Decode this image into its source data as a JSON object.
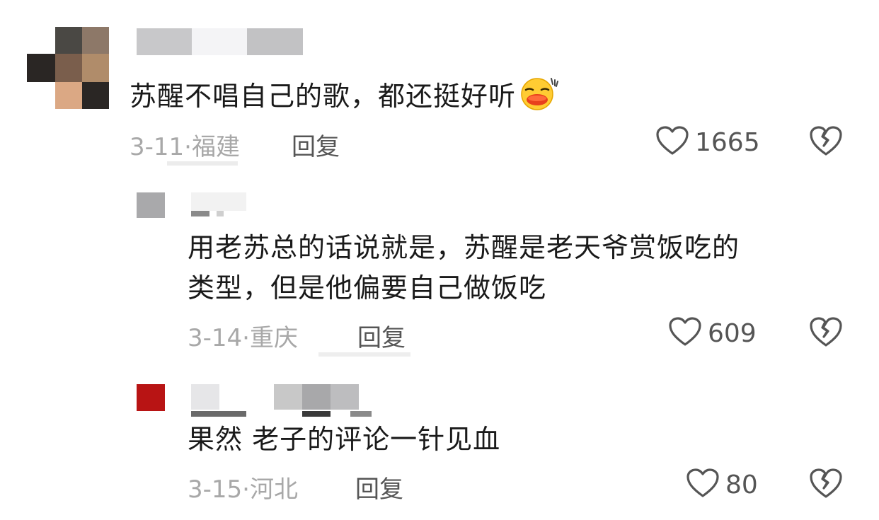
{
  "comments": [
    {
      "text": "苏醒不唱自己的歌，都还挺好听",
      "emoji": "duck-face-emoji",
      "date": "3-11",
      "separator": "·",
      "location": "福建",
      "reply_label": "回复",
      "likes": "1665"
    },
    {
      "text_line1": "用老苏总的话说就是，苏醒是老天爷赏饭吃的",
      "text_line2": "类型，但是他偏要自己做饭吃",
      "date": "3-14",
      "separator": "·",
      "location": "重庆",
      "reply_label": "回复",
      "likes": "609"
    },
    {
      "text": "果然 老子的评论一针见血",
      "date": "3-15",
      "separator": "·",
      "location": "河北",
      "reply_label": "回复",
      "likes": "80"
    }
  ],
  "colors": {
    "text": "#1a1a1a",
    "meta": "#a8a8a8",
    "action": "#555555",
    "avatar_red": "#b81414"
  },
  "icons": {
    "like": "heart-outline-icon",
    "dislike": "broken-heart-icon"
  }
}
